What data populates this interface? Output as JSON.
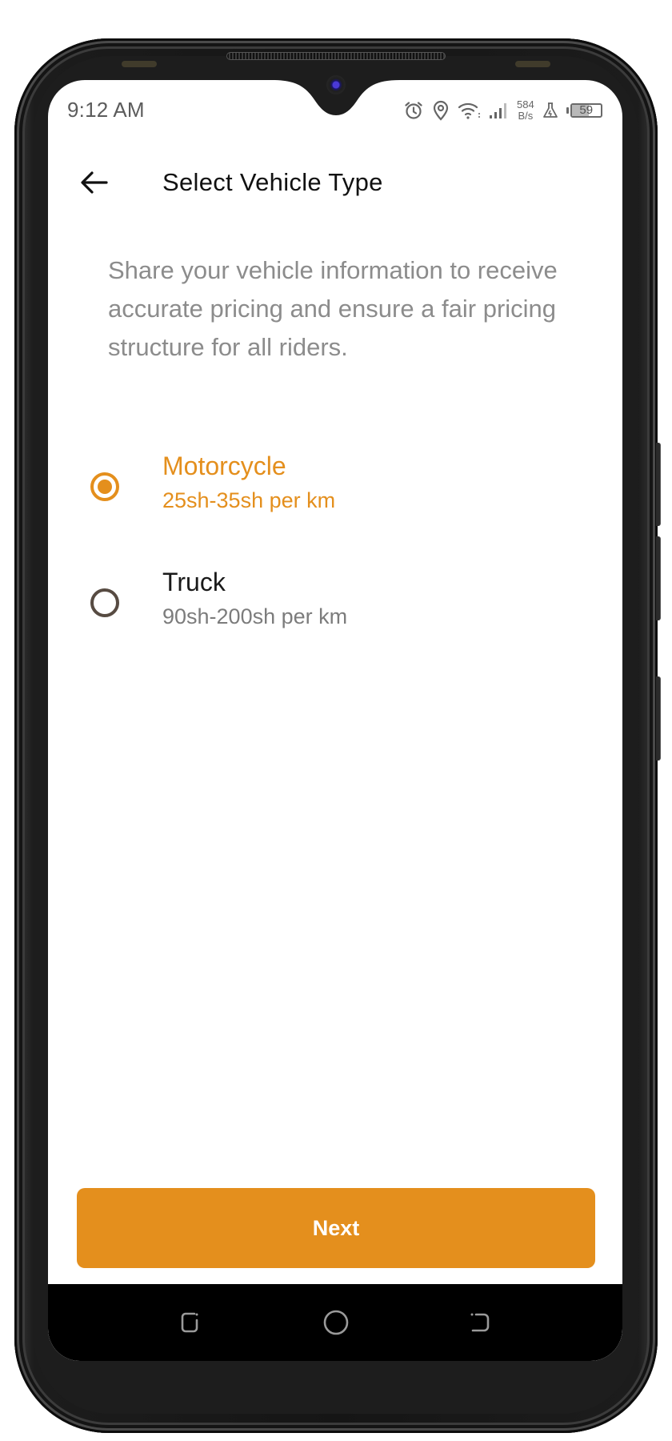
{
  "status_bar": {
    "time": "9:12 AM",
    "icons": [
      "alarm-icon",
      "location-icon",
      "wifi-icon",
      "signal-icon",
      "lab-icon",
      "battery-icon"
    ],
    "net_speed_value": "584",
    "net_speed_unit": "B/s",
    "battery_level": "59"
  },
  "header": {
    "back_icon": "arrow-left-icon",
    "title": "Select Vehicle Type"
  },
  "description": "Share your vehicle information to receive accurate pricing and ensure a fair pricing structure for all riders.",
  "vehicle_options": [
    {
      "name": "Motorcycle",
      "price": "25sh-35sh per km",
      "selected": true
    },
    {
      "name": "Truck",
      "price": "90sh-200sh per km",
      "selected": false
    }
  ],
  "next_button": {
    "label": "Next"
  },
  "nav_bar": {
    "buttons": [
      "recents-icon",
      "home-icon",
      "back-icon"
    ]
  },
  "colors": {
    "accent": "#e48f1d",
    "title": "#111111",
    "description": "#8c8c8c",
    "unselected_radio": "#574b42"
  }
}
